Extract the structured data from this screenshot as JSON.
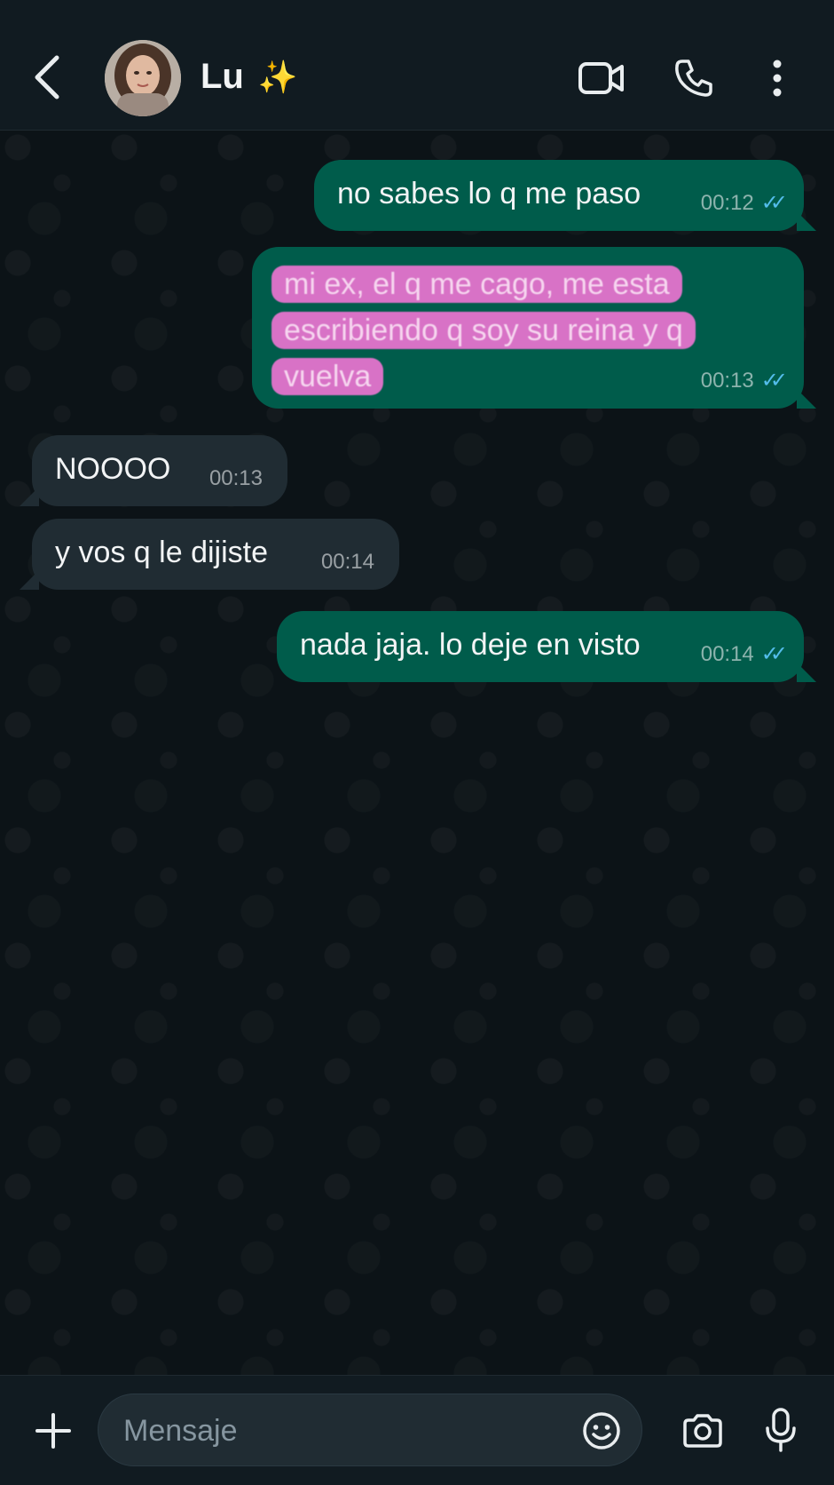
{
  "header": {
    "contact_name": "Lu",
    "contact_emoji": "✨",
    "icons": [
      "chevron-left-icon",
      "video-call-icon",
      "phone-icon",
      "more-vertical-icon"
    ]
  },
  "messages": [
    {
      "direction": "outgoing",
      "text": "no sabes lo q me paso",
      "time": "00:12",
      "status": "read"
    },
    {
      "direction": "outgoing",
      "text": "mi ex, el q me cago, me esta escribiendo q soy su reina y q vuelva",
      "time": "00:13",
      "status": "read",
      "highlighted": true
    },
    {
      "direction": "incoming",
      "text": "NOOOO",
      "time": "00:13"
    },
    {
      "direction": "incoming",
      "text": "y vos q le dijiste",
      "time": "00:14"
    },
    {
      "direction": "outgoing",
      "text": "nada jaja. lo deje en visto",
      "time": "00:14",
      "status": "read"
    }
  ],
  "composer": {
    "placeholder": "Mensaje",
    "icons": [
      "plus-icon",
      "emoji-icon",
      "camera-icon",
      "microphone-icon"
    ]
  },
  "colors": {
    "header_bg": "#111b21",
    "outgoing_bubble": "#005c4b",
    "incoming_bubble": "#202c33",
    "read_ticks": "#53bdeb",
    "highlight": "#d872c6"
  }
}
